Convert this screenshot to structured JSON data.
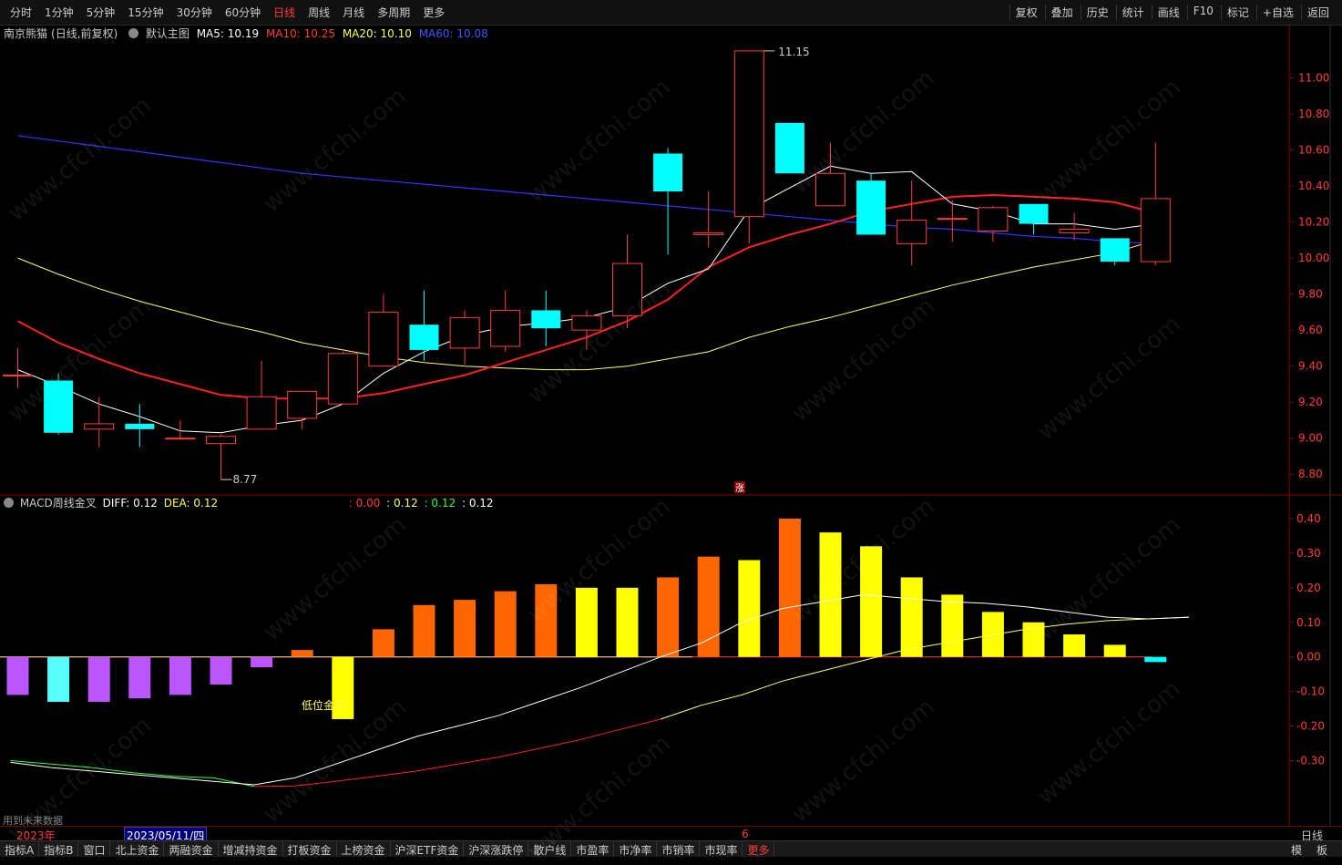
{
  "topbar": {
    "periods": [
      "分时",
      "1分钟",
      "5分钟",
      "15分钟",
      "30分钟",
      "60分钟",
      "日线",
      "周线",
      "月线",
      "多周期",
      "更多"
    ],
    "active_period": "日线",
    "tools": [
      "复权",
      "叠加",
      "历史",
      "统计",
      "画线",
      "F10",
      "标记",
      "+自选",
      "返回"
    ]
  },
  "main_chart": {
    "stock_name": "南京熊猫",
    "mode": "(日线,前复权)",
    "template": "默认主图",
    "ma5_label": "MA5: 10.19",
    "ma10_label": "MA10: 10.25",
    "ma20_label": "MA20: 10.10",
    "ma60_label": "MA60: 10.08",
    "high_label": "11.15",
    "low_label": "8.77",
    "marker": "涨"
  },
  "macd": {
    "name": "MACD周线金叉",
    "diff_label": "DIFF: 0.12",
    "dea_label": "DEA: 0.12",
    "v1": ": 0.00",
    "v2": ": 0.12",
    "v3": ": 0.12",
    "v4": ": 0.12",
    "annotation": "低位金叉",
    "note": "用到未来数据"
  },
  "datebar": {
    "year": "2023年",
    "cursor_date": "2023/05/11/四",
    "month_mark": "6",
    "period": "日线"
  },
  "bottombar": {
    "tabs": [
      "指标A",
      "指标B",
      "窗口",
      "北上资金",
      "两融资金",
      "增减持资金",
      "打板资金",
      "上榜资金",
      "沪深ETF资金",
      "沪深涨跌停",
      "散户线",
      "市盈率",
      "市净率",
      "市销率",
      "市现率",
      "更多"
    ],
    "right_tabs": [
      "模",
      "板"
    ]
  },
  "watermark": "www.cfchi.com",
  "colors": {
    "up": "#ff3b3b",
    "down": "#00ffff",
    "ma5": "#ffffff",
    "ma10": "#ff2020",
    "ma20": "#ffff66",
    "ma60": "#3333ff"
  },
  "chart_data": [
    {
      "type": "candlestick",
      "ylim": [
        8.7,
        11.2
      ],
      "yticks": [
        "11.00",
        "10.80",
        "10.60",
        "10.40",
        "10.20",
        "10.00",
        "9.80",
        "9.60",
        "9.40",
        "9.20",
        "9.00",
        "8.80"
      ],
      "candles": [
        {
          "o": 9.35,
          "c": 9.35,
          "h": 9.5,
          "l": 9.28
        },
        {
          "o": 9.32,
          "c": 9.03,
          "h": 9.36,
          "l": 9.02
        },
        {
          "o": 9.05,
          "c": 9.08,
          "h": 9.23,
          "l": 8.95
        },
        {
          "o": 9.08,
          "c": 9.05,
          "h": 9.19,
          "l": 8.95
        },
        {
          "o": 9.0,
          "c": 9.0,
          "h": 9.1,
          "l": 8.99
        },
        {
          "o": 8.97,
          "c": 9.01,
          "h": 9.02,
          "l": 8.77
        },
        {
          "o": 9.05,
          "c": 9.23,
          "h": 9.43,
          "l": 9.05
        },
        {
          "o": 9.11,
          "c": 9.26,
          "h": 9.26,
          "l": 9.05
        },
        {
          "o": 9.19,
          "c": 9.47,
          "h": 9.48,
          "l": 9.19
        },
        {
          "o": 9.4,
          "c": 9.7,
          "h": 9.8,
          "l": 9.4
        },
        {
          "o": 9.63,
          "c": 9.49,
          "h": 9.82,
          "l": 9.43
        },
        {
          "o": 9.5,
          "c": 9.67,
          "h": 9.71,
          "l": 9.41
        },
        {
          "o": 9.51,
          "c": 9.71,
          "h": 9.82,
          "l": 9.48
        },
        {
          "o": 9.71,
          "c": 9.61,
          "h": 9.82,
          "l": 9.51
        },
        {
          "o": 9.6,
          "c": 9.68,
          "h": 9.71,
          "l": 9.49
        },
        {
          "o": 9.68,
          "c": 9.97,
          "h": 10.13,
          "l": 9.61
        },
        {
          "o": 10.58,
          "c": 10.37,
          "h": 10.61,
          "l": 10.02
        },
        {
          "o": 10.13,
          "c": 10.14,
          "h": 10.37,
          "l": 10.06
        },
        {
          "o": 10.23,
          "c": 11.15,
          "h": 11.15,
          "l": 10.08
        },
        {
          "o": 10.75,
          "c": 10.47,
          "h": 10.75,
          "l": 10.47
        },
        {
          "o": 10.29,
          "c": 10.47,
          "h": 10.64,
          "l": 10.29
        },
        {
          "o": 10.43,
          "c": 10.13,
          "h": 10.47,
          "l": 10.13
        },
        {
          "o": 10.08,
          "c": 10.21,
          "h": 10.43,
          "l": 9.96
        },
        {
          "o": 10.22,
          "c": 10.22,
          "h": 10.32,
          "l": 10.09
        },
        {
          "o": 10.15,
          "c": 10.28,
          "h": 10.29,
          "l": 10.09
        },
        {
          "o": 10.3,
          "c": 10.19,
          "h": 10.3,
          "l": 10.13
        },
        {
          "o": 10.14,
          "c": 10.16,
          "h": 10.25,
          "l": 10.1
        },
        {
          "o": 10.11,
          "c": 9.98,
          "h": 10.11,
          "l": 9.96
        },
        {
          "o": 9.98,
          "c": 10.33,
          "h": 10.64,
          "l": 9.96
        }
      ],
      "ma5": [
        9.38,
        9.29,
        9.19,
        9.12,
        9.04,
        9.03,
        9.07,
        9.1,
        9.19,
        9.36,
        9.48,
        9.57,
        9.62,
        9.64,
        9.67,
        9.73,
        9.86,
        9.94,
        10.27,
        10.39,
        10.51,
        10.47,
        10.48,
        10.3,
        10.26,
        10.19,
        10.19,
        10.16,
        10.19
      ],
      "ma10": [
        9.65,
        9.53,
        9.44,
        9.36,
        9.3,
        9.24,
        9.22,
        9.22,
        9.22,
        9.25,
        9.3,
        9.35,
        9.42,
        9.49,
        9.56,
        9.65,
        9.77,
        9.95,
        10.06,
        10.13,
        10.19,
        10.26,
        10.3,
        10.34,
        10.35,
        10.34,
        10.33,
        10.31,
        10.25
      ],
      "ma20": [
        10.0,
        9.91,
        9.83,
        9.76,
        9.7,
        9.64,
        9.59,
        9.53,
        9.49,
        9.45,
        9.42,
        9.4,
        9.39,
        9.38,
        9.38,
        9.4,
        9.44,
        9.48,
        9.56,
        9.62,
        9.67,
        9.73,
        9.79,
        9.85,
        9.9,
        9.95,
        9.99,
        10.03,
        10.1
      ],
      "ma60": [
        10.68,
        10.65,
        10.62,
        10.59,
        10.56,
        10.53,
        10.5,
        10.47,
        10.45,
        10.43,
        10.41,
        10.39,
        10.37,
        10.35,
        10.33,
        10.31,
        10.29,
        10.27,
        10.25,
        10.23,
        10.21,
        10.19,
        10.17,
        10.16,
        10.14,
        10.12,
        10.11,
        10.09,
        10.08
      ]
    },
    {
      "type": "bar",
      "title": "MACD周线金叉",
      "ylim": [
        -0.42,
        0.45
      ],
      "yticks": [
        "0.40",
        "0.30",
        "0.20",
        "0.10",
        "0.00",
        "-0.10",
        "-0.20",
        "-0.30"
      ],
      "macd": [
        -0.11,
        -0.13,
        -0.13,
        -0.12,
        -0.11,
        -0.08,
        -0.03,
        0.02,
        -0.18,
        0.08,
        0.15,
        0.165,
        0.19,
        0.21,
        0.2,
        0.2,
        0.23,
        0.29,
        0.28,
        0.4,
        0.36,
        0.32,
        0.23,
        0.18,
        0.13,
        0.1,
        0.065,
        0.035,
        -0.015
      ],
      "bar_colors": [
        "#bb55ff",
        "#55ffff",
        "#bb55ff",
        "#bb55ff",
        "#bb55ff",
        "#bb55ff",
        "#bb55ff",
        "#ff6600",
        "#ffff00",
        "#ff6600",
        "#ff6600",
        "#ff6600",
        "#ff6600",
        "#ff6600",
        "#ffff00",
        "#ffff00",
        "#ff6600",
        "#ff6600",
        "#ffff00",
        "#ff6600",
        "#ffff00",
        "#ffff00",
        "#ffff00",
        "#ffff00",
        "#ffff00",
        "#ffff00",
        "#ffff00",
        "#ffff00",
        "#00ffff"
      ],
      "diff": [
        -0.305,
        -0.32,
        -0.33,
        -0.34,
        -0.35,
        -0.36,
        -0.37,
        -0.35,
        -0.31,
        -0.27,
        -0.23,
        -0.2,
        -0.17,
        -0.13,
        -0.09,
        -0.045,
        0.0,
        0.04,
        0.1,
        0.14,
        0.16,
        0.18,
        0.17,
        0.16,
        0.155,
        0.145,
        0.13,
        0.115,
        0.11,
        0.115
      ],
      "dea": [
        -0.3,
        -0.31,
        -0.32,
        -0.335,
        -0.345,
        -0.35,
        -0.375,
        -0.373,
        -0.36,
        -0.345,
        -0.33,
        -0.31,
        -0.29,
        -0.265,
        -0.24,
        -0.21,
        -0.18,
        -0.14,
        -0.11,
        -0.07,
        -0.04,
        -0.01,
        0.02,
        0.04,
        0.06,
        0.08,
        0.095,
        0.105,
        0.11,
        0.115
      ],
      "dea_green_until": 6
    }
  ]
}
